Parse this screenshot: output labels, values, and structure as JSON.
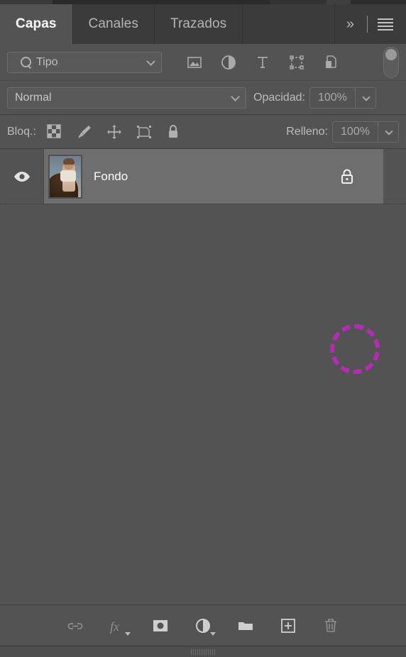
{
  "panel": {
    "tabs": [
      {
        "label": "Capas",
        "active": true
      },
      {
        "label": "Canales",
        "active": false
      },
      {
        "label": "Trazados",
        "active": false
      }
    ],
    "header_icons": {
      "collapse_label": "»",
      "menu_name": "panel-menu-icon"
    }
  },
  "filter_row": {
    "filter_type_label": "Tipo",
    "search_icon": "search-icon",
    "type_filters": [
      {
        "name": "filter-pixel-layers-icon",
        "title": "Pixel"
      },
      {
        "name": "filter-adjustment-layers-icon",
        "title": "Ajuste"
      },
      {
        "name": "filter-type-layers-icon",
        "title": "Texto"
      },
      {
        "name": "filter-shape-layers-icon",
        "title": "Forma"
      },
      {
        "name": "filter-smart-object-layers-icon",
        "title": "Objeto inteligente"
      }
    ],
    "toggle_name": "filter-enable-toggle",
    "toggle_state": "off"
  },
  "blend_row": {
    "blend_mode": "Normal",
    "opacity_label": "Opacidad:",
    "opacity_value": "100%"
  },
  "lock_row": {
    "lock_label": "Bloq.:",
    "lock_icons": [
      {
        "name": "lock-transparent-pixels-icon"
      },
      {
        "name": "lock-image-pixels-icon"
      },
      {
        "name": "lock-position-icon"
      },
      {
        "name": "lock-artboard-nesting-icon"
      },
      {
        "name": "lock-all-icon"
      }
    ],
    "fill_label": "Relleno:",
    "fill_value": "100%"
  },
  "layers": [
    {
      "name": "Fondo",
      "visible": true,
      "locked": true,
      "selected": true,
      "thumbnail": "child-on-animal-photo"
    }
  ],
  "annotation": {
    "shape": "dashed-circle",
    "color": "#b42cb4",
    "target": "layer-lock-indicator"
  },
  "bottom_toolbar": [
    {
      "name": "link-layers-icon",
      "label": "Enlazar capas"
    },
    {
      "name": "layer-style-fx-icon",
      "label": "fx"
    },
    {
      "name": "add-layer-mask-icon",
      "label": "Añadir máscara de capa"
    },
    {
      "name": "new-adjustment-layer-icon",
      "label": "Nueva capa de ajuste"
    },
    {
      "name": "new-group-icon",
      "label": "Nuevo grupo"
    },
    {
      "name": "new-layer-icon",
      "label": "Nueva capa"
    },
    {
      "name": "delete-layer-icon",
      "label": "Eliminar capa"
    }
  ]
}
